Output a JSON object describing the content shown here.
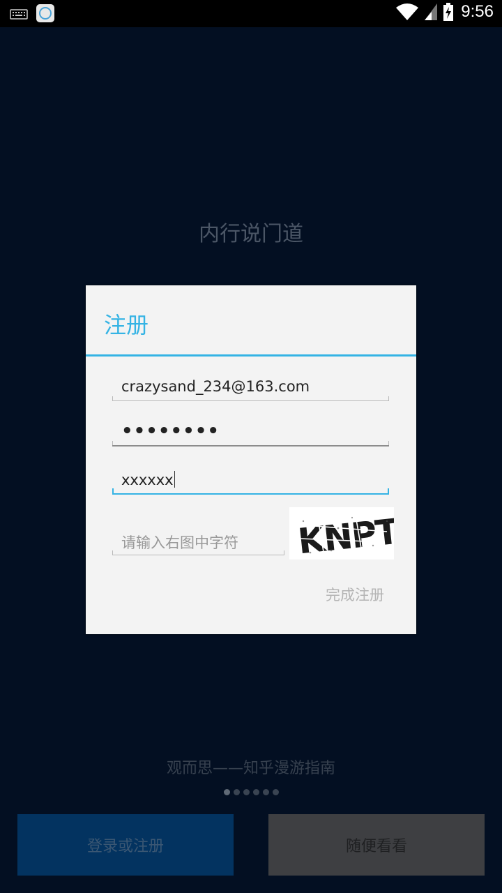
{
  "status_bar": {
    "time": "9:56",
    "icons": [
      "keyboard-icon",
      "app-icon",
      "wifi-icon",
      "signal-icon",
      "battery-charging-icon"
    ]
  },
  "background": {
    "headline": "内行说门道",
    "subtitle": "观而思——知乎漫游指南",
    "page_dots": 6,
    "active_dot": 0
  },
  "dialog": {
    "title": "注册",
    "email_value": "crazysand_234@163.com",
    "password_masked": "••••••••",
    "name_value": "xxxxxx",
    "captcha_placeholder": "请输入右图中字符",
    "captcha_text": "KNPT",
    "submit_label": "完成注册"
  },
  "bottom_buttons": {
    "login_label": "登录或注册",
    "browse_label": "随便看看"
  },
  "colors": {
    "accent": "#34b3e4",
    "background": "#030f22",
    "login_button": "#033360",
    "browse_button": "#3e3f42"
  }
}
